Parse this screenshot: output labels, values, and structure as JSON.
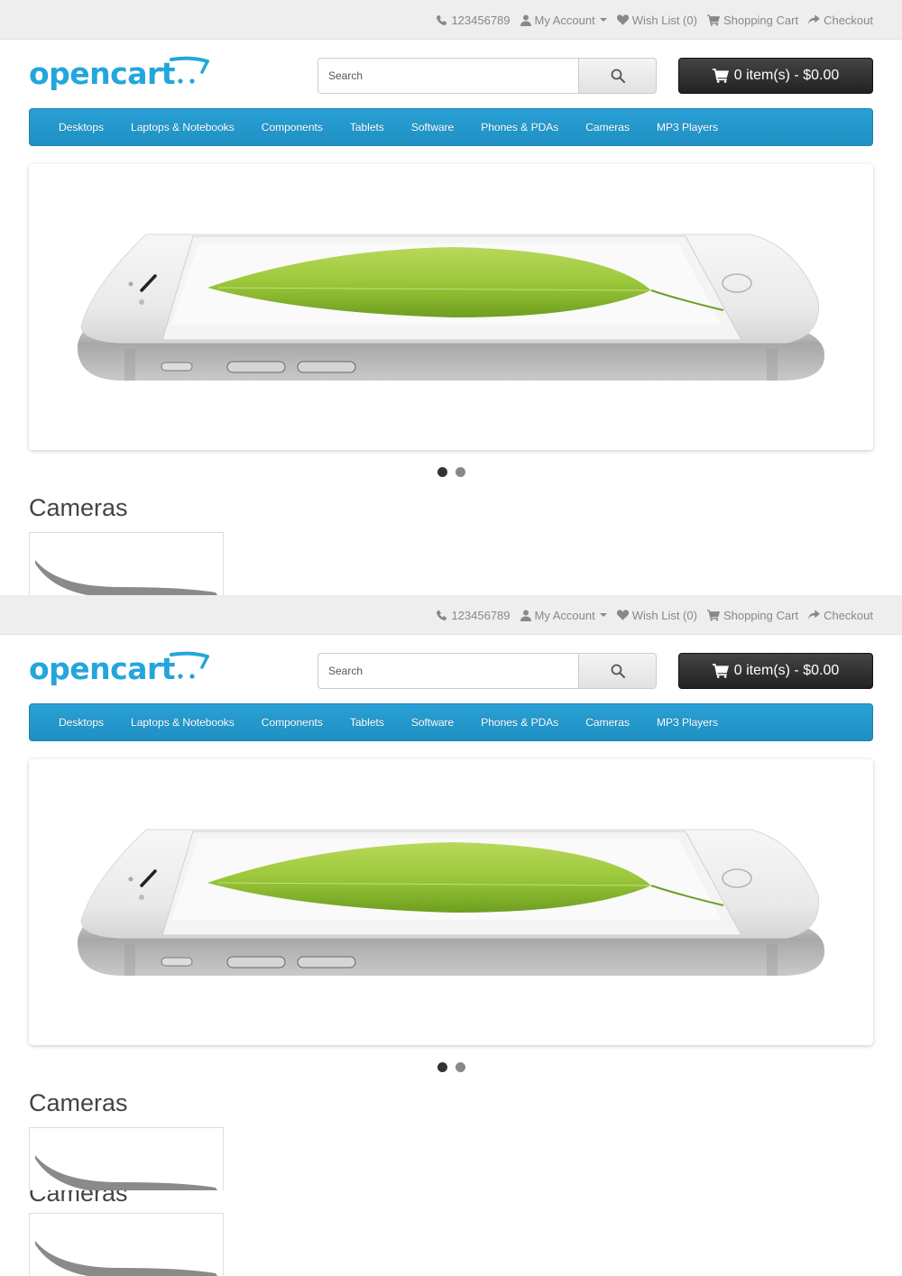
{
  "topbar": {
    "phone": "123456789",
    "my_account": "My Account",
    "wish_list": "Wish List (0)",
    "shopping_cart": "Shopping Cart",
    "checkout": "Checkout"
  },
  "header": {
    "logo_text": "opencart",
    "search_placeholder": "Search",
    "cart_button": "0 item(s) - $0.00"
  },
  "menu": {
    "items": [
      "Desktops",
      "Laptops & Notebooks",
      "Components",
      "Tablets",
      "Software",
      "Phones & PDAs",
      "Cameras",
      "MP3 Players"
    ]
  },
  "slideshow": {
    "slide_count": 2,
    "active_index": 0
  },
  "featured": {
    "title": "Cameras"
  },
  "colors": {
    "menu_blue": "#229ac8",
    "logo_blue": "#23a6dc",
    "cart_button": "#333333",
    "topbar_bg": "#eeeeee"
  }
}
